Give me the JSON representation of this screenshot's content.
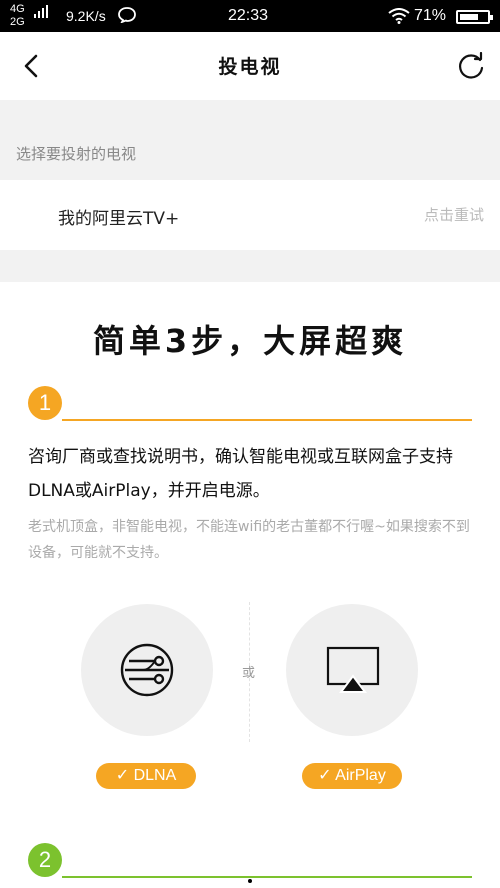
{
  "status_bar": {
    "network_top": "4G",
    "network_bottom": "2G",
    "speed": "9.2K/s",
    "time": "22:33",
    "battery": "71%",
    "battery_level": 0.71,
    "icons": [
      "signal-icon",
      "message-icon",
      "wifi-icon",
      "battery-icon"
    ]
  },
  "nav": {
    "title": "投电视",
    "back_icon": "chevron-left-icon",
    "refresh_icon": "refresh-icon"
  },
  "device_section": {
    "header": "选择要投射的电视",
    "device_name": "我的阿里云TV+",
    "retry_label": "点击重试"
  },
  "guide": {
    "headline": "简单3步，大屏超爽",
    "step1": {
      "number": "1",
      "text": "咨询厂商或查找说明书，确认智能电视或互联网盒子支持DLNA或AirPlay，并开启电源。",
      "note": "老式机顶盒，非智能电视，不能连wifi的老古董都不行喔~如果搜索不到设备，可能就不支持。"
    },
    "options": {
      "or_label": "或",
      "dlna_label": "✓ DLNA",
      "airplay_label": "✓ AirPlay",
      "dlna_icon": "dlna-icon",
      "airplay_icon": "airplay-icon"
    },
    "step2": {
      "number": "2"
    }
  },
  "colors": {
    "step1_accent": "#F5A623",
    "step2_accent": "#7CC22E",
    "badge": "#F5A623",
    "background_gray": "#F2F2F2"
  }
}
